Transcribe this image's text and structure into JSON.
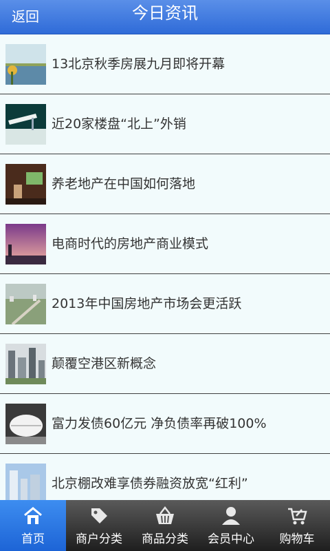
{
  "header": {
    "back_label": "返回",
    "title": "今日资讯"
  },
  "news": [
    {
      "title": "13北京秋季房展九月即将开幕"
    },
    {
      "title": "近20家楼盘“北上”外销"
    },
    {
      "title": "养老地产在中国如何落地"
    },
    {
      "title": "电商时代的房地产商业模式"
    },
    {
      "title": "2013年中国房地产市场会更活跃"
    },
    {
      "title": "颠覆空港区新概念"
    },
    {
      "title": "富力发债60亿元 净负债率再破100%"
    },
    {
      "title": "北京棚改难享债券融资放宽“红利”"
    }
  ],
  "tabs": [
    {
      "label": "首页",
      "icon": "home-icon",
      "active": true
    },
    {
      "label": "商户分类",
      "icon": "tag-icon",
      "active": false
    },
    {
      "label": "商品分类",
      "icon": "basket-icon",
      "active": false
    },
    {
      "label": "会员中心",
      "icon": "user-icon",
      "active": false
    },
    {
      "label": "购物车",
      "icon": "cart-icon",
      "active": false
    }
  ],
  "colors": {
    "header": "#2f6bd8",
    "tab_active": "#1d64d6",
    "tabbar": "#2a2a2a"
  }
}
